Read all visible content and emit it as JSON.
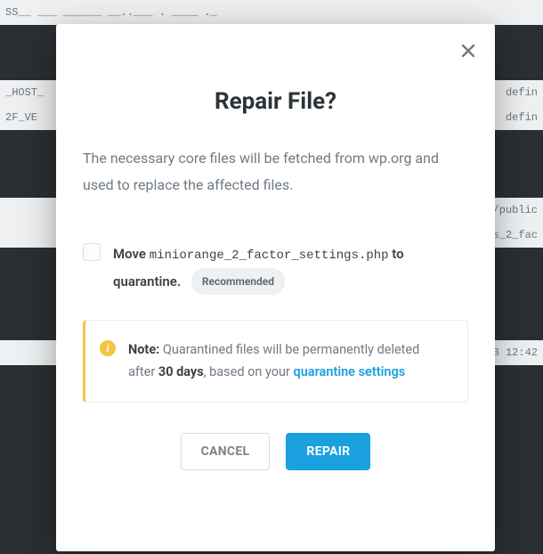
{
  "bg": {
    "row1_left": "SS__ ___ ______ __..___ . ____ ._",
    "row2_left": "_HOST_",
    "row2_right": "defin",
    "row3_left": "2F_VE",
    "row3_right": "defin",
    "rowA_right": "/public",
    "rowB_right": "s_2_fac",
    "rowC_right": "3 12:42"
  },
  "modal": {
    "title": "Repair File?",
    "description": "The necessary core files will be fetched from wp.org and used to replace the affected files.",
    "checkbox": {
      "prefix": "Move ",
      "filename": "miniorange_2_factor_settings.php",
      "suffix": " to quarantine.",
      "badge": "Recommended"
    },
    "note": {
      "label": "Note:",
      "text1": " Quarantined files will be permanently deleted after ",
      "days": "30 days",
      "text2": ", based on your ",
      "link": "quarantine settings"
    },
    "buttons": {
      "cancel": "CANCEL",
      "repair": "REPAIR"
    }
  }
}
